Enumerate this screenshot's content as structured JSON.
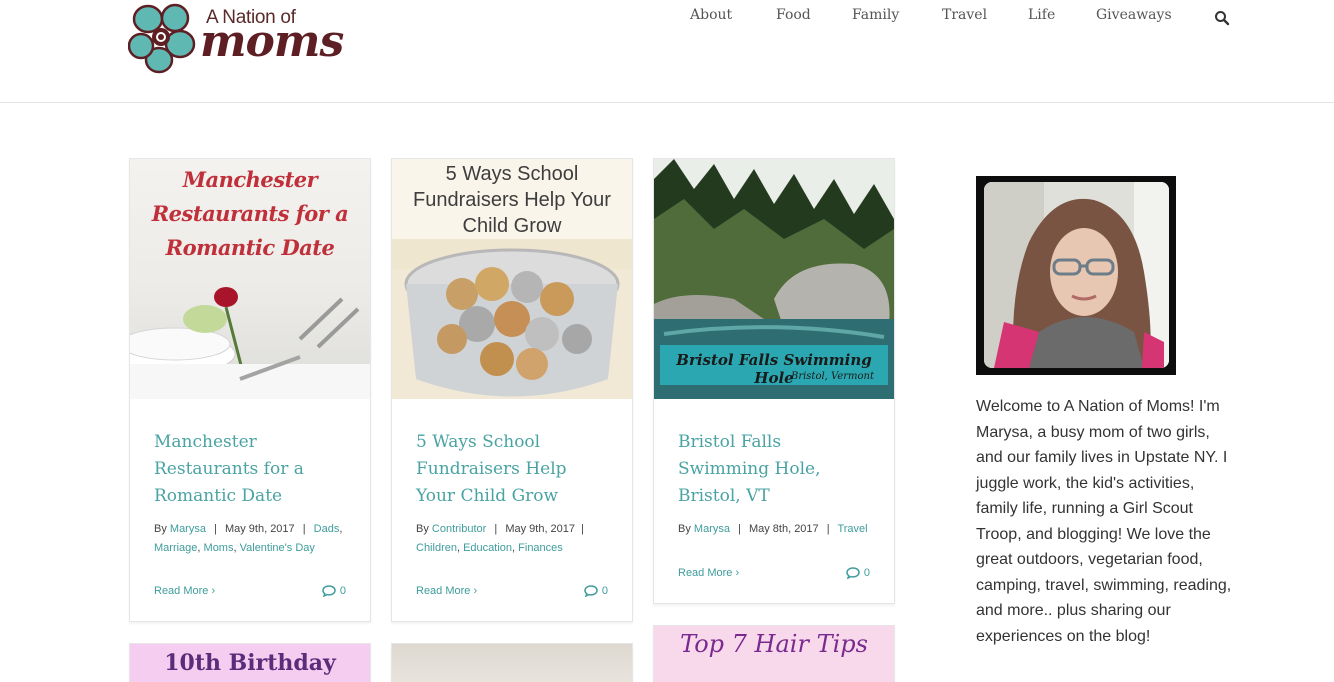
{
  "logo": {
    "line1": "A Nation of",
    "line2": "moms"
  },
  "nav": {
    "items": [
      "About",
      "Food",
      "Family",
      "Travel",
      "Life",
      "Giveaways"
    ]
  },
  "cards": [
    {
      "image_text": "Manchester Restaurants for a Romantic Date",
      "title": "Manchester Restaurants for a Romantic Date",
      "by": "By",
      "author": "Marysa",
      "sep": "|",
      "date": "May 9th, 2017",
      "cats": [
        "Dads",
        "Marriage",
        "Moms",
        "Valentine's Day"
      ],
      "read_more": "Read More",
      "comments": "0"
    },
    {
      "image_text": "5 Ways School Fundraisers Help Your Child Grow",
      "title": "5 Ways School Fundraisers Help Your Child Grow",
      "by": "By",
      "author": "Contributor",
      "sep": "|",
      "date": "May 9th, 2017",
      "cats": [
        "Children",
        "Education",
        "Finances"
      ],
      "read_more": "Read More",
      "comments": "0"
    },
    {
      "image_text": "Bristol Falls Swimming Hole",
      "image_subtext": "Bristol, Vermont",
      "title": "Bristol Falls Swimming Hole, Bristol, VT",
      "by": "By",
      "author": "Marysa",
      "sep": "|",
      "date": "May 8th, 2017",
      "cats": [
        "Travel"
      ],
      "read_more": "Read More",
      "comments": "0"
    }
  ],
  "next_cards": [
    {
      "image_text": "10th Birthday"
    },
    {
      "image_text": ""
    },
    {
      "image_text": "Top 7 Hair Tips"
    }
  ],
  "sidebar": {
    "welcome": "Welcome to A Nation of Moms! I'm Marysa, a busy mom of two girls, and our family lives in Upstate NY. I juggle work, the kid's activities, family life, running a Girl Scout Troop, and blogging! We love the great outdoors, vegetarian food, camping, travel, swimming, reading, and more.. plus sharing our experiences on the blog!"
  },
  "colors": {
    "accent": "#4aa3a3",
    "logo_flower": "#5fb8b2",
    "logo_text": "#5e1f24"
  }
}
